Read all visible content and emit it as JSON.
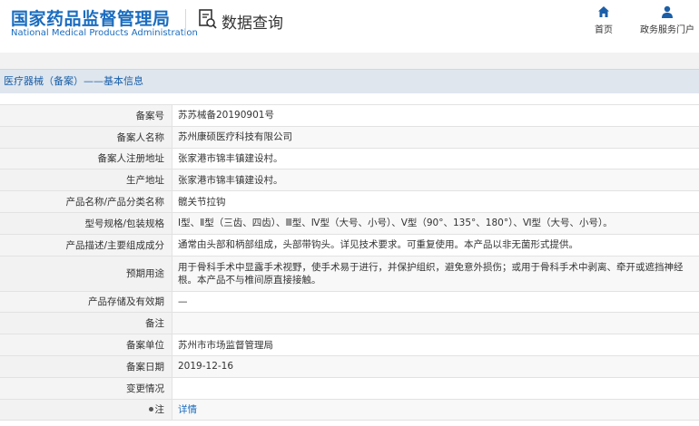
{
  "header": {
    "logo_cn": "国家药品监督管理局",
    "logo_en": "National Medical Products Administration",
    "section_title": "数据查询",
    "nav": [
      {
        "label": "首页",
        "icon": "home-icon"
      },
      {
        "label": "政务服务门户",
        "icon": "user-icon"
      }
    ]
  },
  "breadcrumb": "医疗器械（备案）——基本信息",
  "rows": [
    {
      "label": "备案号",
      "value": "苏苏械备20190901号"
    },
    {
      "label": "备案人名称",
      "value": "苏州康硕医疗科技有限公司"
    },
    {
      "label": "备案人注册地址",
      "value": "张家港市锦丰镇建设村。"
    },
    {
      "label": "生产地址",
      "value": "张家港市锦丰镇建设村。"
    },
    {
      "label": "产品名称/产品分类名称",
      "value": "髋关节拉钩"
    },
    {
      "label": "型号规格/包装规格",
      "value": "Ⅰ型、Ⅱ型（三齿、四齿）、Ⅲ型、Ⅳ型（大号、小号）、Ⅴ型（90°、135°、180°）、Ⅵ型（大号、小号）。"
    },
    {
      "label": "产品描述/主要组成成分",
      "value": "通常由头部和柄部组成，头部带钩头。详见技术要求。可重复使用。本产品以非无菌形式提供。"
    },
    {
      "label": "预期用途",
      "value": "用于骨科手术中显露手术视野，使手术易于进行，并保护组织，避免意外损伤；或用于骨科手术中剥离、牵开或遮挡神经根。本产品不与椎间原直接接触。"
    },
    {
      "label": "产品存储及有效期",
      "value": "—"
    },
    {
      "label": "备注",
      "value": ""
    },
    {
      "label": "备案单位",
      "value": "苏州市市场监督管理局"
    },
    {
      "label": "备案日期",
      "value": "2019-12-16"
    },
    {
      "label": "变更情况",
      "value": ""
    },
    {
      "label": "注",
      "value": "详情"
    }
  ]
}
